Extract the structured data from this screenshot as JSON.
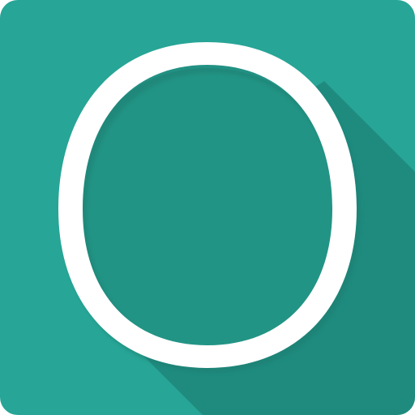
{
  "icon": {
    "name": "letter-o-app-icon",
    "glyph": "O",
    "colors": {
      "tile": "#27A596",
      "long_shadow": "#1F8B7F",
      "glyph_fill": "#ffffff",
      "glyph_inner": "#229485",
      "glyph_shadow": "#1A7A6E"
    }
  }
}
